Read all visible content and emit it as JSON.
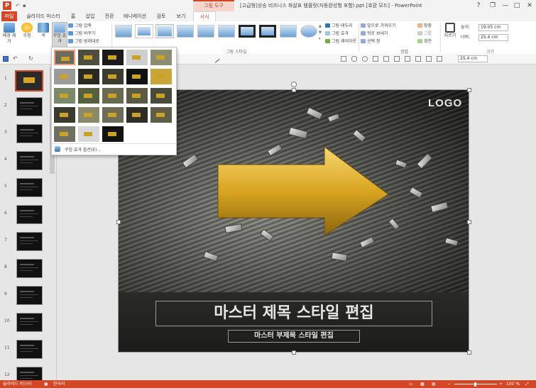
{
  "titlebar": {
    "app_icon": "P",
    "context_group": "그림 도구",
    "document_title": "[고급형]상승 비즈니스 화살표 템플릿(자동완성형 포함).ppt [호환 모드] - PowerPoint",
    "help": "?",
    "restore": "❐",
    "minimize": "—",
    "maximize": "□",
    "close": "✕"
  },
  "tabs": [
    "파일",
    "슬라이드 마스터",
    "홈",
    "삽입",
    "전환",
    "애니메이션",
    "검토",
    "보기",
    "서식"
  ],
  "ribbon": {
    "remove_bg": "배경 제거",
    "corrections": "수정",
    "color": "색",
    "artistic": "꾸밈 효과",
    "compress": "그림 압축",
    "change": "그림 바꾸기",
    "reset": "그림 원래대로",
    "styles_group": "그림 스타일",
    "border": "그림 테두리",
    "effects": "그림 효과",
    "layout": "그림 레이아웃",
    "bring_forward": "앞으로 가져오기",
    "send_backward": "뒤로 보내기",
    "selection_pane": "선택 창",
    "align": "맞춤",
    "group": "그룹",
    "rotate": "회전",
    "arrange_group": "정렬",
    "crop": "자르기",
    "height_label": "높이:",
    "height_value": "19.05 cm",
    "width_label": "너비:",
    "width_value": "25.4 cm",
    "size_group": "크기"
  },
  "toolbar": {
    "size_value": "25.4 cm"
  },
  "gallery": {
    "footer_label": "꾸밈 효과 옵션(E)..."
  },
  "slide": {
    "logo": "LOGO",
    "title": "마스터 제목 스타일 편집",
    "subtitle": "마스터 부제목 스타일 편집"
  },
  "thumbnails": {
    "numbers": [
      "1",
      "2",
      "3",
      "4",
      "5",
      "6",
      "7",
      "8",
      "9",
      "10",
      "11",
      "12"
    ]
  },
  "statusbar": {
    "view": "슬라이드 마스터",
    "language": "한국어",
    "zoom": "100 %"
  },
  "colors": {
    "accent": "#d24726",
    "arrow_gold": "#d9a520"
  }
}
